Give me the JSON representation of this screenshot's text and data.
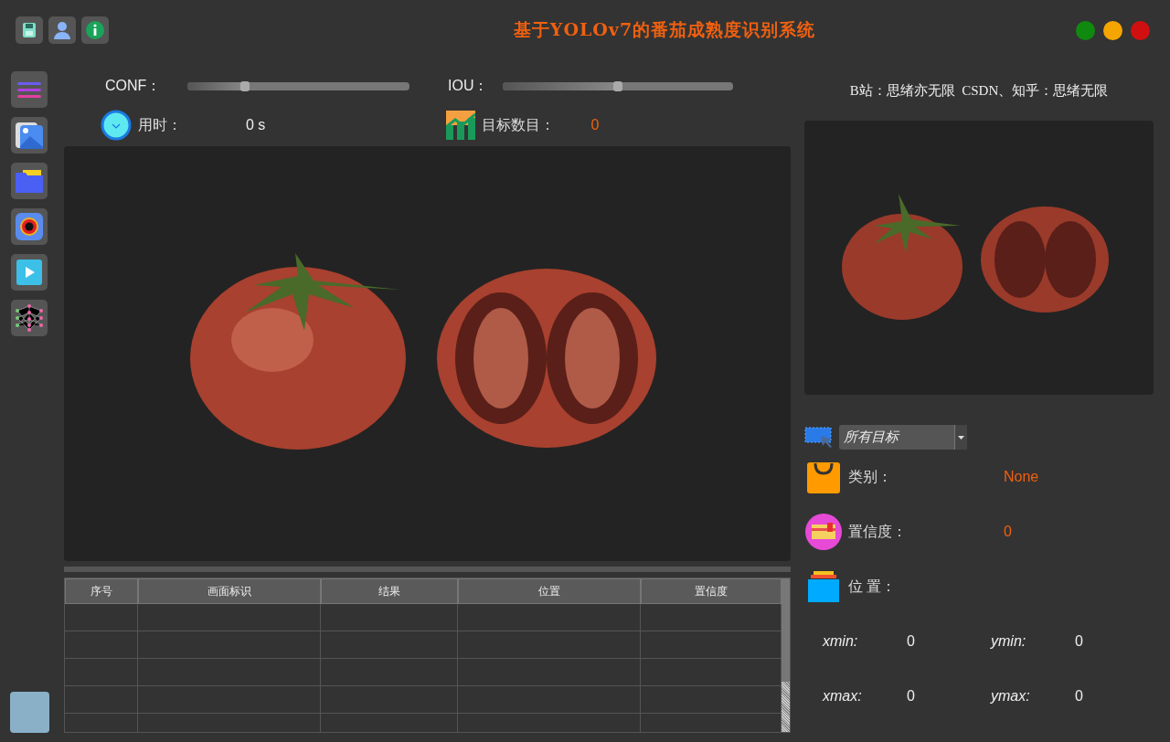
{
  "window": {
    "title": "基于YOLOv7的番茄成熟度识别系统",
    "controls": [
      {
        "color": "#0f8a0f"
      },
      {
        "color": "#f5a500"
      },
      {
        "color": "#d01010"
      }
    ]
  },
  "sliders": [
    {
      "label": "CONF：",
      "level": 0.26
    },
    {
      "label": "IOU：",
      "level": 0.5
    }
  ],
  "stats": [
    {
      "label": "用时：",
      "value": "0 s"
    },
    {
      "label": "目标数目：",
      "value": "0"
    }
  ],
  "credits": "B站：思绪亦无限  CSDN、知乎：思绪无限",
  "target_select": {
    "value": "所有目标"
  },
  "details": [
    {
      "label": "类别：",
      "value": "None"
    },
    {
      "label": "置信度：",
      "value": "0"
    },
    {
      "label": "位 置："
    }
  ],
  "coords": [
    {
      "label": "xmin:",
      "value": "0"
    },
    {
      "label": "ymin:",
      "value": "0"
    },
    {
      "label": "xmax:",
      "value": "0"
    },
    {
      "label": "ymax:",
      "value": "0"
    }
  ],
  "table": {
    "columns": [
      "序号",
      "画面标识",
      "结果",
      "位置",
      "置信度"
    ]
  }
}
